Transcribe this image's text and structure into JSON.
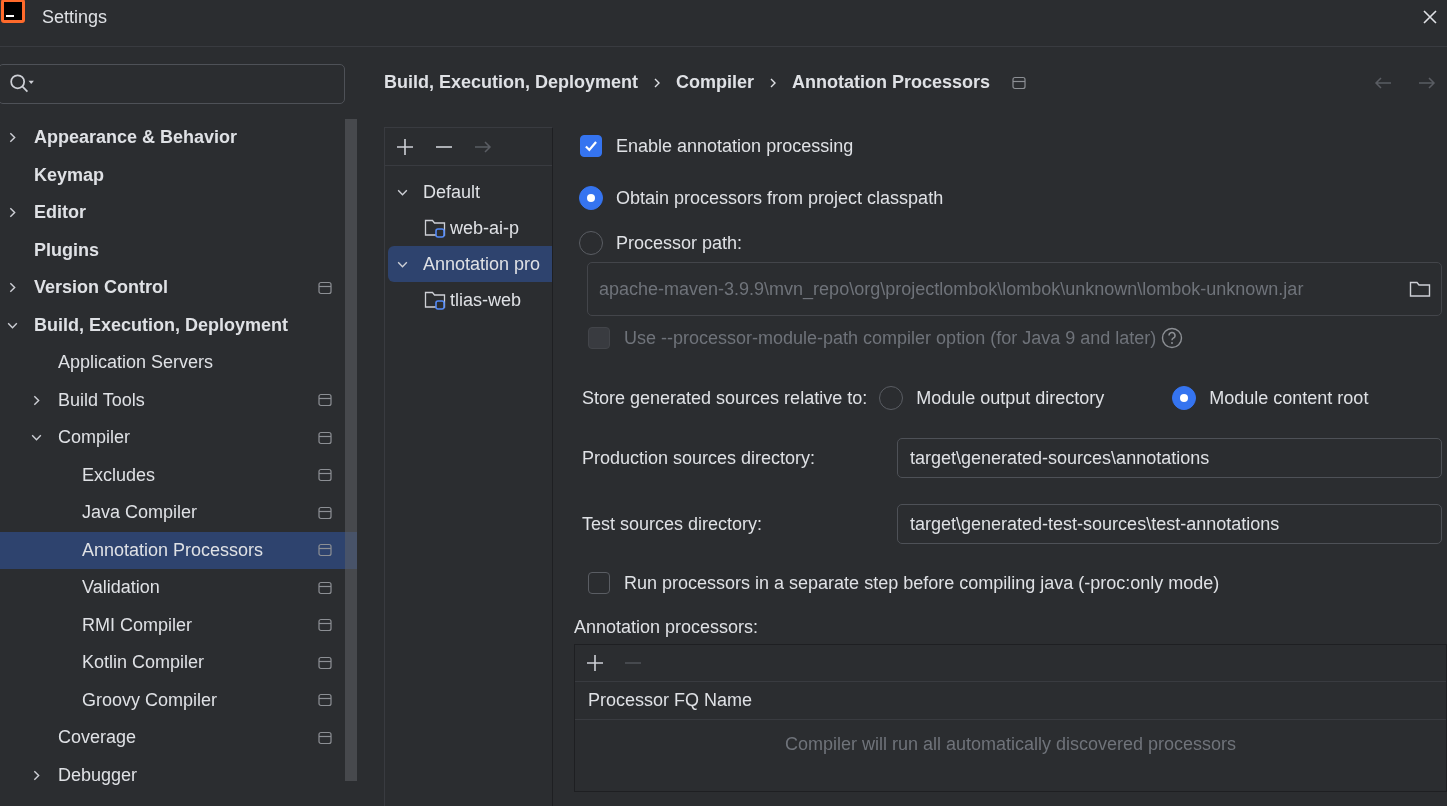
{
  "window": {
    "title": "Settings"
  },
  "sidebar": {
    "items": [
      {
        "label": "Appearance & Behavior",
        "expanded": false
      },
      {
        "label": "Keymap"
      },
      {
        "label": "Editor",
        "expanded": false
      },
      {
        "label": "Plugins"
      },
      {
        "label": "Version Control",
        "expanded": false,
        "project_scope": true
      },
      {
        "label": "Build, Execution, Deployment",
        "expanded": true,
        "children": [
          {
            "label": "Application Servers"
          },
          {
            "label": "Build Tools",
            "expanded": false,
            "project_scope": true
          },
          {
            "label": "Compiler",
            "expanded": true,
            "project_scope": true,
            "children": [
              {
                "label": "Excludes",
                "project_scope": true,
                "selected": false
              },
              {
                "label": "Java Compiler",
                "project_scope": true,
                "selected": false
              },
              {
                "label": "Annotation Processors",
                "project_scope": true,
                "selected": true
              },
              {
                "label": "Validation",
                "project_scope": true,
                "selected": false
              },
              {
                "label": "RMI Compiler",
                "project_scope": true,
                "selected": false
              },
              {
                "label": "Kotlin Compiler",
                "project_scope": true,
                "selected": false
              },
              {
                "label": "Groovy Compiler",
                "project_scope": true,
                "selected": false
              }
            ]
          },
          {
            "label": "Coverage",
            "project_scope": true
          },
          {
            "label": "Debugger",
            "expanded": false
          }
        ]
      }
    ]
  },
  "breadcrumb": [
    "Build, Execution, Deployment",
    "Compiler",
    "Annotation Processors"
  ],
  "profiles": {
    "items": [
      {
        "label": "Default",
        "expanded": true,
        "selected": false,
        "children": [
          {
            "label": "web-ai-p",
            "selected": false
          }
        ]
      },
      {
        "label": "Annotation pro",
        "expanded": true,
        "selected": true,
        "children": [
          {
            "label": "tlias-web",
            "selected": false
          }
        ]
      }
    ]
  },
  "enable_processing": {
    "label": "Enable annotation processing",
    "checked": true
  },
  "processor_source": [
    {
      "label": "Obtain processors from project classpath",
      "selected": true
    },
    {
      "label": "Processor path:",
      "selected": false
    }
  ],
  "processor_path": {
    "value": "apache-maven-3.9.9\\mvn_repo\\org\\projectlombok\\lombok\\unknown\\lombok-unknown.jar",
    "disabled": true
  },
  "module_path_option": {
    "label": "Use --processor-module-path compiler option (for Java 9 and later)",
    "checked": false,
    "disabled": true
  },
  "store_relative": {
    "label": "Store generated sources relative to:",
    "options": [
      {
        "label": "Module output directory",
        "selected": false
      },
      {
        "label": "Module content root",
        "selected": true
      }
    ]
  },
  "directories": [
    {
      "label": "Production sources directory:",
      "value": "target\\generated-sources\\annotations"
    },
    {
      "label": "Test sources directory:",
      "value": "target\\generated-test-sources\\test-annotations"
    }
  ],
  "proc_only": {
    "label": "Run processors in a separate step before compiling java (-proc:only mode)",
    "checked": false
  },
  "processors_table": {
    "title": "Annotation processors:",
    "columns": [
      "Processor FQ Name"
    ],
    "empty_text": "Compiler will run all automatically discovered processors"
  }
}
